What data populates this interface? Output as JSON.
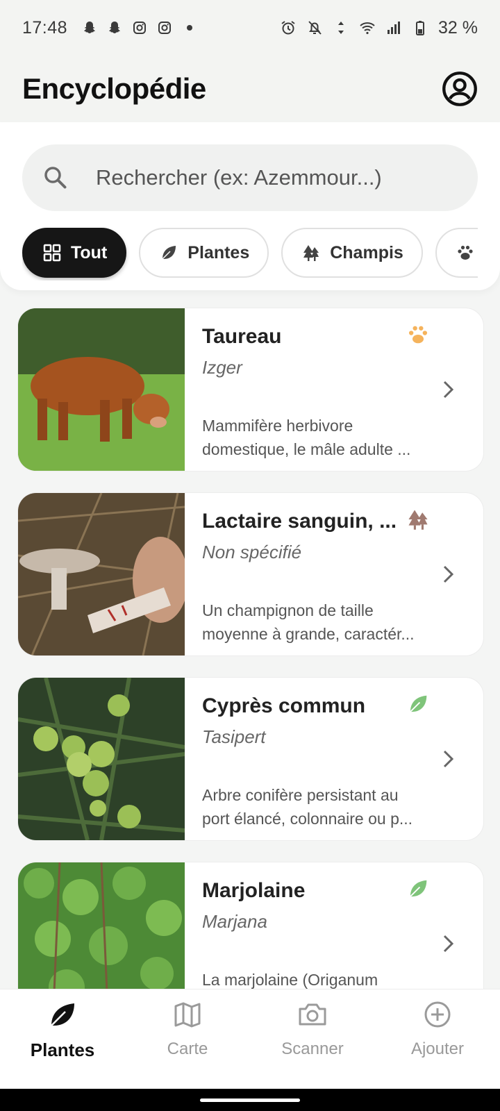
{
  "status_bar": {
    "time": "17:48",
    "notification_icons": [
      "snapchat-icon",
      "snapchat-icon",
      "instagram-icon",
      "instagram-icon",
      "dot-icon"
    ],
    "system_icons": [
      "alarm-icon",
      "bell-off-icon",
      "data-arrows-icon",
      "wifi-icon",
      "signal-icon",
      "battery-icon"
    ],
    "battery": "32 %"
  },
  "header": {
    "title": "Encyclopédie",
    "profile_icon": "account-circle-icon"
  },
  "search": {
    "placeholder": "Rechercher (ex: Azemmour...)",
    "icon": "search-icon"
  },
  "filters": [
    {
      "label": "Tout",
      "icon": "grid-icon",
      "active": true
    },
    {
      "label": "Plantes",
      "icon": "leaf-icon",
      "active": false
    },
    {
      "label": "Champis",
      "icon": "trees-icon",
      "active": false
    },
    {
      "label": "",
      "icon": "paw-icon",
      "active": false
    }
  ],
  "items": [
    {
      "title": "Taureau",
      "subtitle": "Izger",
      "category_icon": "paw-icon",
      "category_color": "#f5b35c",
      "desc_line1": "Mammifère herbivore",
      "desc_line2": "domestique, le mâle adulte ..."
    },
    {
      "title": "Lactaire sanguin, ...",
      "subtitle": "Non spécifié",
      "category_icon": "trees-icon",
      "category_color": "#a07a70",
      "desc_line1": "Un champignon de taille",
      "desc_line2": "moyenne à grande, caractér..."
    },
    {
      "title": "Cyprès commun",
      "subtitle": "Tasipert",
      "category_icon": "leaf-icon",
      "category_color": "#7fc47a",
      "desc_line1": "Arbre conifère persistant au",
      "desc_line2": "port élancé, colonnaire ou p..."
    },
    {
      "title": "Marjolaine",
      "subtitle": "Marjana",
      "category_icon": "leaf-icon",
      "category_color": "#7fc47a",
      "desc_line1": "La marjolaine (Origanum",
      "desc_line2": ""
    }
  ],
  "bottom_nav": [
    {
      "label": "Plantes",
      "icon": "leaf-icon",
      "active": true
    },
    {
      "label": "Carte",
      "icon": "map-icon",
      "active": false
    },
    {
      "label": "Scanner",
      "icon": "camera-icon",
      "active": false
    },
    {
      "label": "Ajouter",
      "icon": "add-circle-icon",
      "active": false
    }
  ]
}
